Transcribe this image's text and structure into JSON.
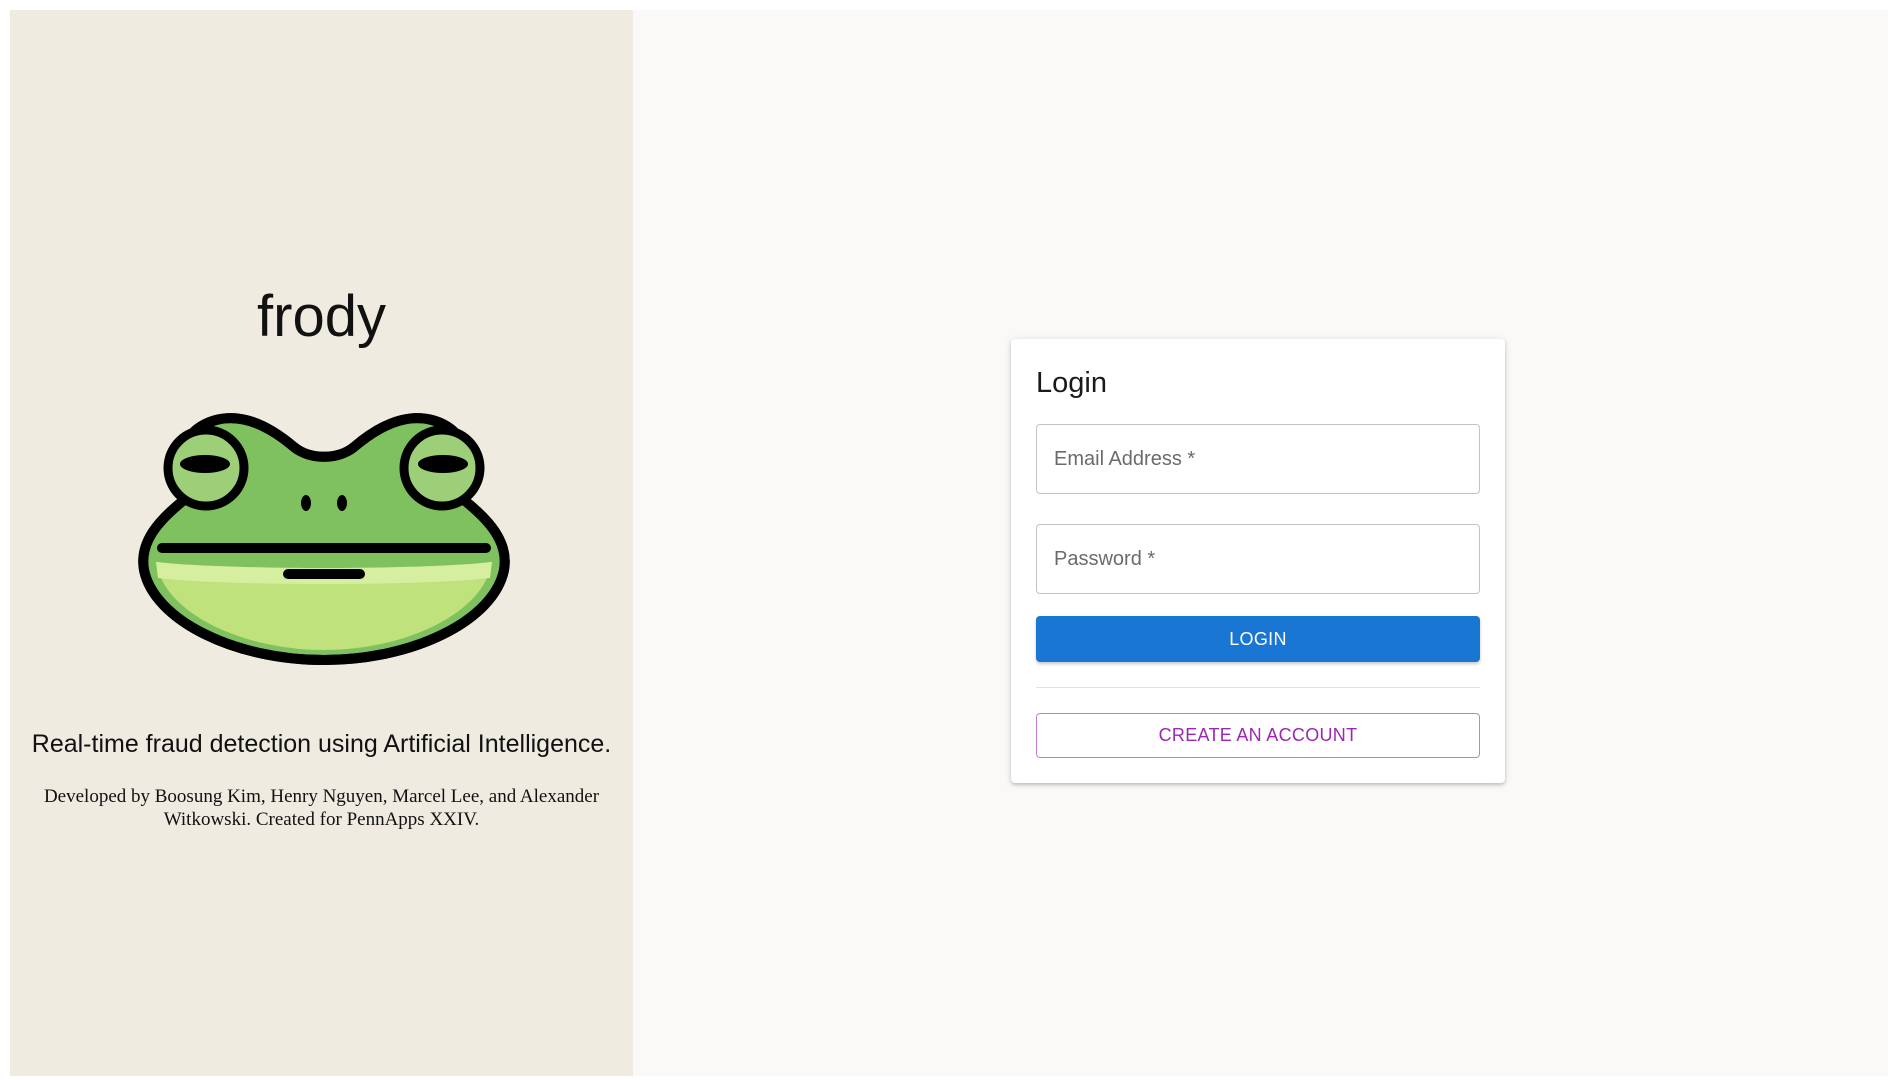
{
  "brand": {
    "title": "frody",
    "logo_icon": "frog-face-icon",
    "tagline": "Real-time fraud detection using Artificial Intelligence.",
    "credits": "Developed by Boosung Kim, Henry Nguyen, Marcel Lee, and Alexander Witkowski. Created for PennApps XXIV."
  },
  "login": {
    "title": "Login",
    "email_placeholder": "Email Address *",
    "email_value": "",
    "password_placeholder": "Password *",
    "password_value": "",
    "login_label": "LOGIN",
    "create_account_label": "CREATE AN ACCOUNT"
  },
  "colors": {
    "left_panel_bg": "#efebe1",
    "right_panel_bg": "#faf9f7",
    "primary": "#1976d2",
    "secondary": "#9c27b0",
    "frog_green": "#7fc15e",
    "frog_belly": "#bfe27c"
  }
}
